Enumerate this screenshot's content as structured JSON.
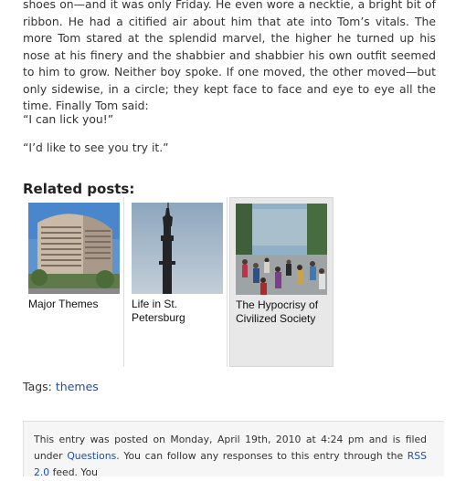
{
  "article": {
    "paragraph_1": "shoes on—and it was only Friday. He even wore a necktie, a bright bit of ribbon. He had a citified air about him that ate into Tom’s vitals. The more Tom stared at the splendid marvel, the higher he turned up his nose at his finery and the shabbier and shabbier his own outfit seemed to him to grow. Neither boy spoke. If one moved, the other moved—but only sidewise, in a circle; they kept face to face and eye to eye all the time. Finally Tom said:",
    "paragraph_2": "“I can lick you!”",
    "paragraph_3": "“I’d like to see you try it.”"
  },
  "related": {
    "heading": "Related posts:",
    "posts": [
      {
        "title": "Major Themes",
        "image": "hotel-building-photo"
      },
      {
        "title": "Life in St. Petersburg",
        "image": "column-statue-photo"
      },
      {
        "title": "The Hypocrisy of Civilized Society",
        "image": "crowd-street-photo"
      }
    ]
  },
  "tags": {
    "label": "Tags:",
    "items": [
      "themes"
    ]
  },
  "entry_meta": {
    "text_1": "This entry was posted on Monday, April 19th, 2010 at 4:24 pm and is filed under ",
    "category_link": "Questions",
    "text_2": ". You can follow any responses to this entry through the ",
    "rss_link": "RSS 2.0",
    "text_3": " feed. You"
  },
  "colors": {
    "link": "#1d4ea8",
    "body_text": "#333333",
    "hover_background": "#e8e8e8"
  }
}
